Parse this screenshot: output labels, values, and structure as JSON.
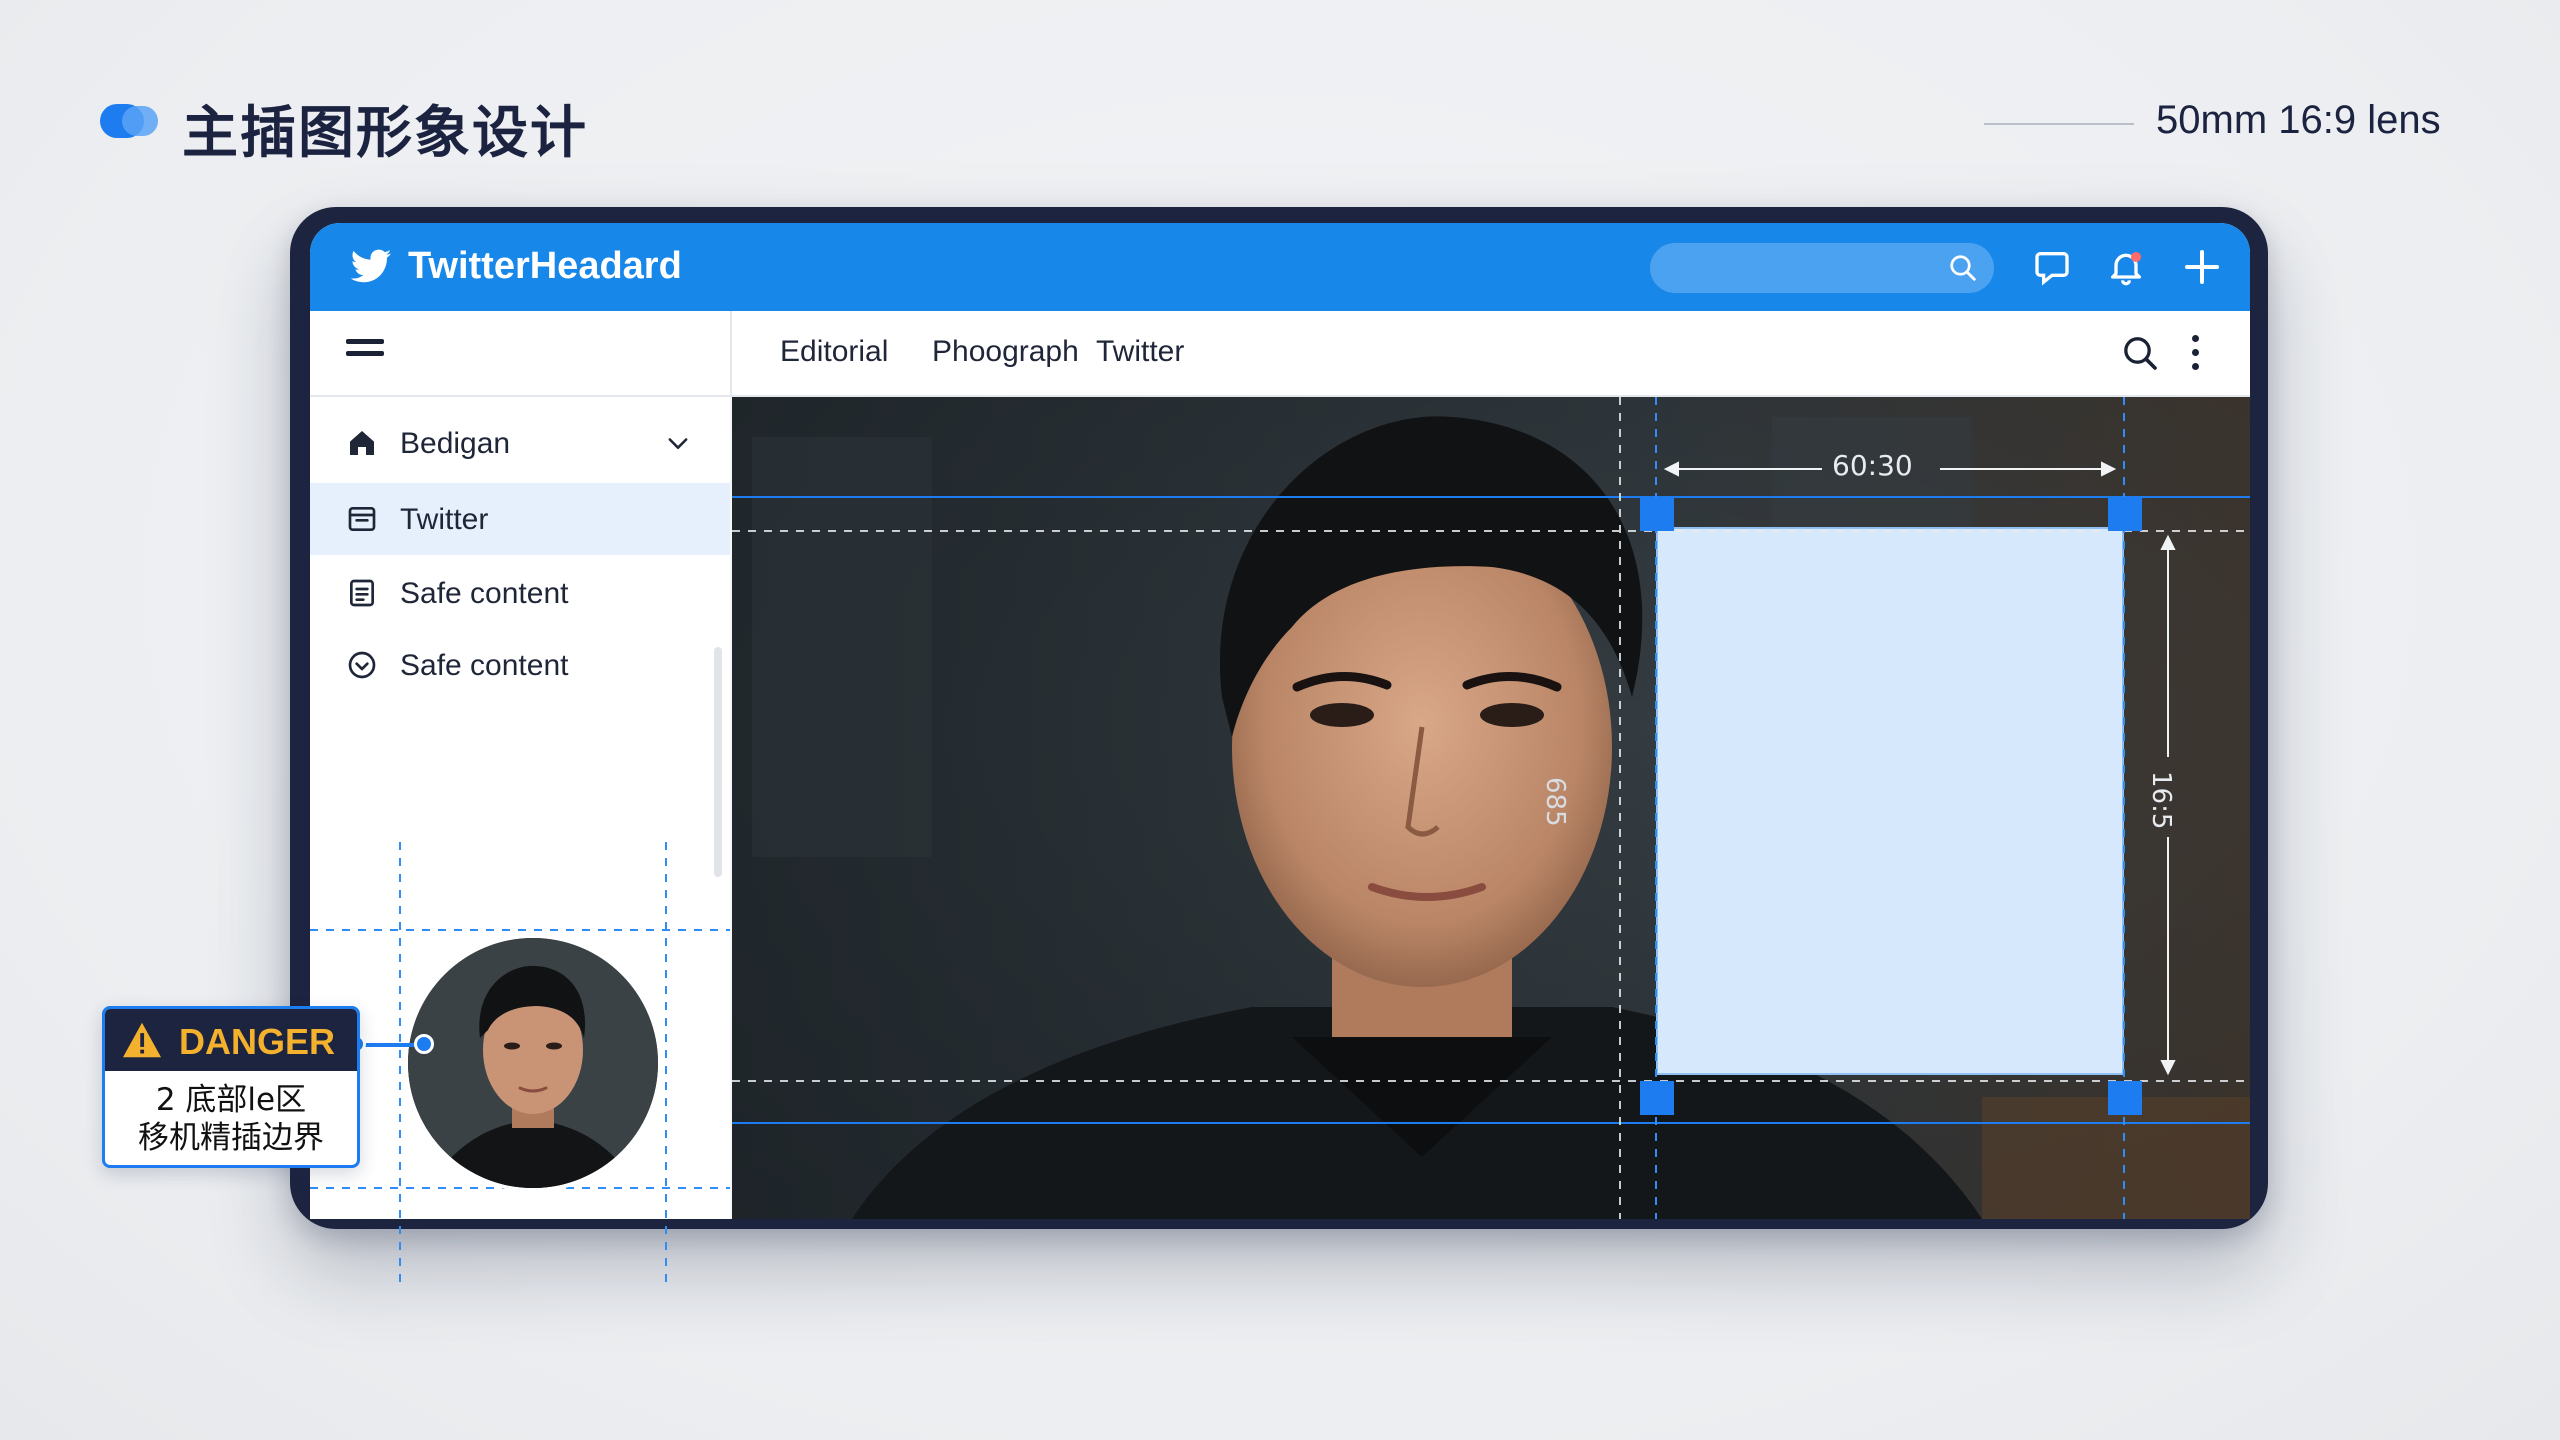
{
  "slide": {
    "title": "主插图形象设计",
    "lens": "50mm 16:9 lens"
  },
  "app": {
    "brand": "TwitterHeadard",
    "search_placeholder": "",
    "tabs": [
      "Editorial",
      "Phoograph",
      "Twitter"
    ],
    "sidebar": [
      {
        "label": "Bedigan",
        "icon": "home-icon",
        "active": false,
        "expandable": true
      },
      {
        "label": "Twitter",
        "icon": "inbox-icon",
        "active": true,
        "expandable": false
      },
      {
        "label": "Safe content",
        "icon": "document-icon",
        "active": false,
        "expandable": false
      },
      {
        "label": "Safe content",
        "icon": "check-circle-icon",
        "active": false,
        "expandable": false
      }
    ]
  },
  "measurements": {
    "top": "60:30",
    "left": "685",
    "right": "16:5"
  },
  "callout": {
    "label": "DANGER",
    "line1": "2 底部le区",
    "line2": "移机精插边界"
  },
  "colors": {
    "accent": "#1787ea",
    "frame": "#1d2440",
    "warning": "#f4b12e",
    "crop_fill": "#d6e8fb"
  }
}
